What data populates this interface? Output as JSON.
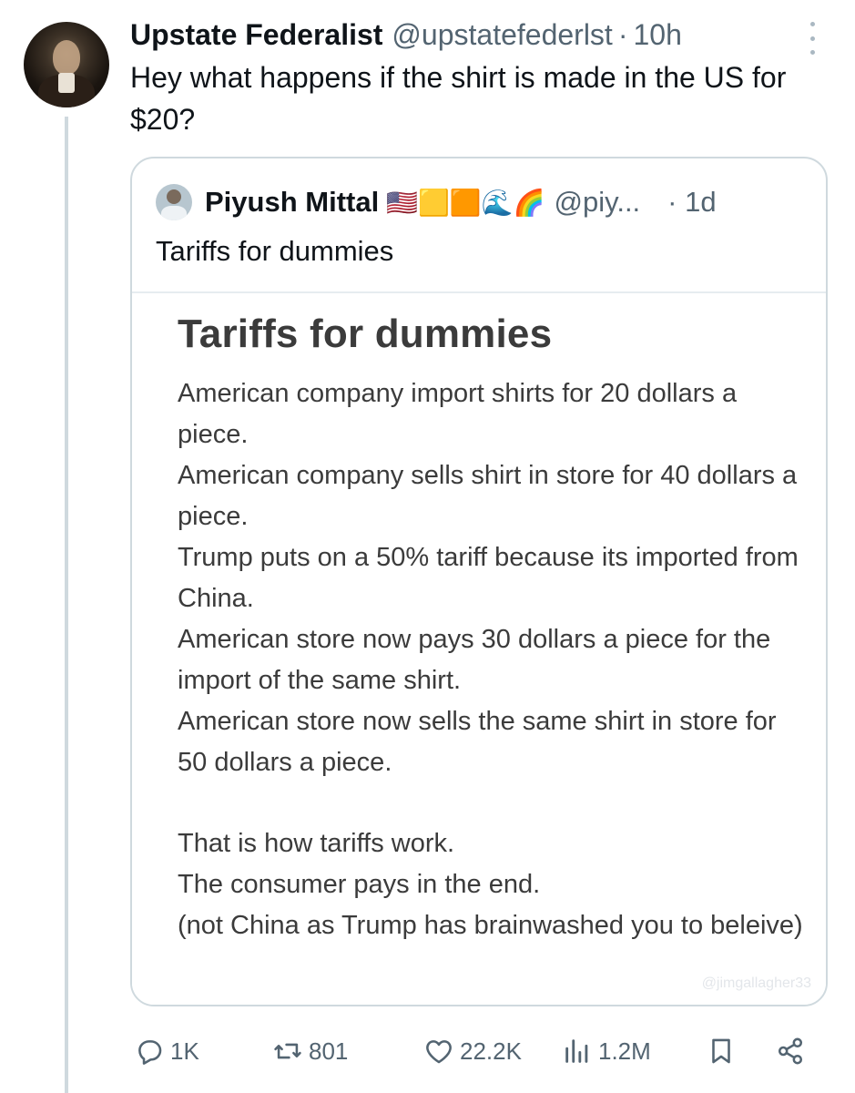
{
  "tweet": {
    "author_name": "Upstate Federalist",
    "author_handle": "@upstatefederlst",
    "separator": "·",
    "time": "10h",
    "text": "Hey what happens if the shirt is made in the US for $20?"
  },
  "quote": {
    "author_name": "Piyush Mittal",
    "emojis": "🇺🇸🟨🟧🌊🌈",
    "author_handle": "@piy...",
    "time": "· 1d",
    "text": "Tariffs for dummies",
    "image": {
      "title": "Tariffs for dummies",
      "lines": [
        "American company import shirts for 20 dollars a piece.",
        "American company sells shirt in store for 40 dollars a piece.",
        "Trump puts on a 50% tariff because its imported from China.",
        "American store now pays 30 dollars a piece for the import of the same shirt.",
        "American store now sells the same shirt in store for 50 dollars a piece.",
        "That is how tariffs work.",
        "The consumer pays in the end.",
        "(not China as Trump has brainwashed you to beleive)"
      ],
      "watermark": "@jimgallagher33"
    }
  },
  "actions": {
    "replies": "1K",
    "reposts": "801",
    "likes": "22.2K",
    "views": "1.2M"
  },
  "icons": [
    "reply-icon",
    "repost-icon",
    "like-icon",
    "views-icon",
    "bookmark-icon",
    "share-icon",
    "more-icon"
  ]
}
